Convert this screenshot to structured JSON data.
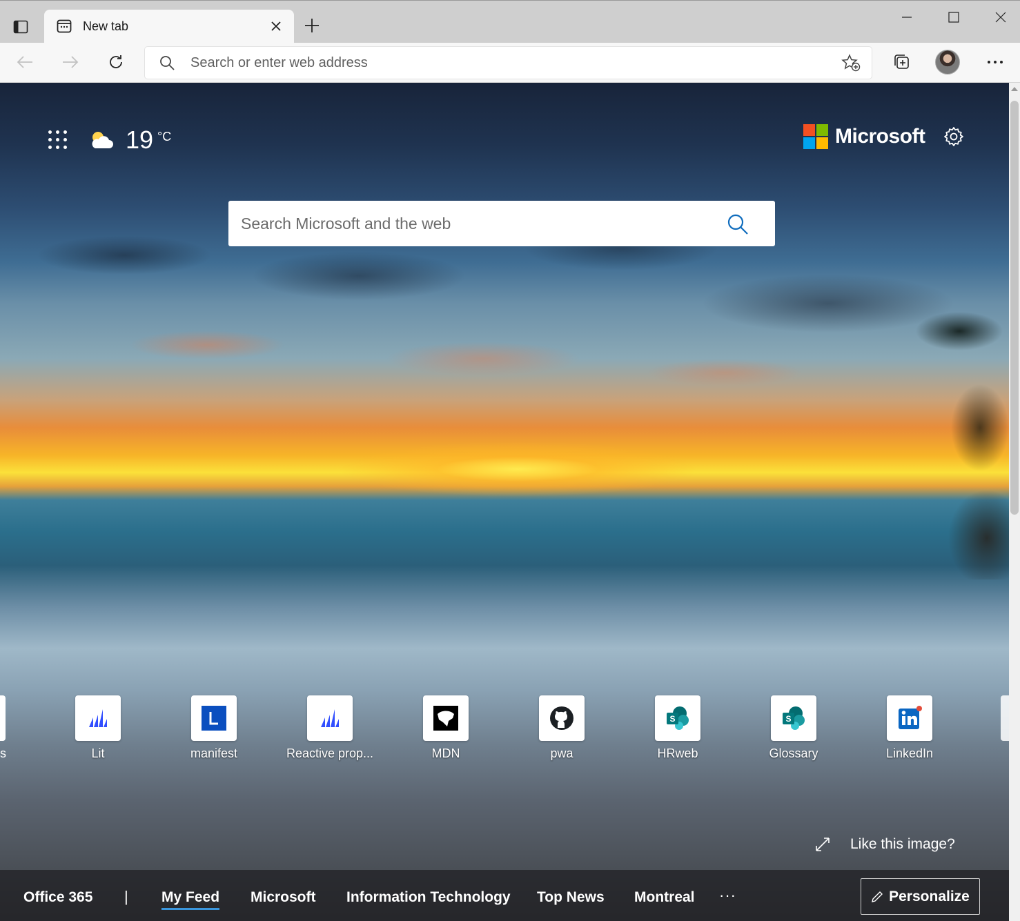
{
  "browser": {
    "tab": {
      "title": "New tab"
    },
    "address_bar": {
      "placeholder": "Search or enter web address"
    }
  },
  "newtab_page": {
    "weather": {
      "temperature": "19",
      "unit": "°C"
    },
    "brand": "Microsoft",
    "search": {
      "placeholder": "Search Microsoft and the web"
    },
    "partial_tile_label": "s",
    "quick_links": [
      {
        "label": "Lit",
        "icon": "lit-icon"
      },
      {
        "label": "manifest",
        "icon": "letter-l-icon"
      },
      {
        "label": "Reactive prop...",
        "icon": "lit-icon"
      },
      {
        "label": "MDN",
        "icon": "mdn-icon"
      },
      {
        "label": "pwa",
        "icon": "github-icon"
      },
      {
        "label": "HRweb",
        "icon": "sharepoint-icon"
      },
      {
        "label": "Glossary",
        "icon": "sharepoint-icon"
      },
      {
        "label": "LinkedIn",
        "icon": "linkedin-icon"
      }
    ],
    "like_image": "Like this image?",
    "feed_nav": {
      "office": "Office 365",
      "separator": "|",
      "items": [
        "My Feed",
        "Microsoft",
        "Information Technology",
        "Top News",
        "Montreal"
      ],
      "more": "···",
      "personalize": "Personalize"
    },
    "colors": {
      "accent": "#3a96dd",
      "ms_red": "#f25022",
      "ms_green": "#7fba00",
      "ms_blue": "#00a4ef",
      "ms_yellow": "#ffb900"
    }
  }
}
